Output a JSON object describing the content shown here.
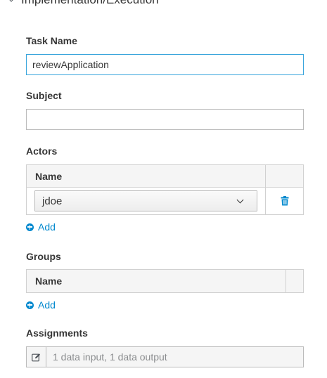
{
  "section": {
    "title": "Implementation/Execution"
  },
  "task_name": {
    "label": "Task Name",
    "value": "reviewApplication"
  },
  "subject": {
    "label": "Subject",
    "value": ""
  },
  "actors": {
    "label": "Actors",
    "column_name": "Name",
    "rows": [
      {
        "value": "jdoe"
      }
    ],
    "add_label": "Add"
  },
  "groups": {
    "label": "Groups",
    "column_name": "Name",
    "add_label": "Add"
  },
  "assignments": {
    "label": "Assignments",
    "value": "1 data input, 1 data output"
  },
  "colors": {
    "accent": "#0088ce",
    "focus_border": "#39a5dc"
  }
}
